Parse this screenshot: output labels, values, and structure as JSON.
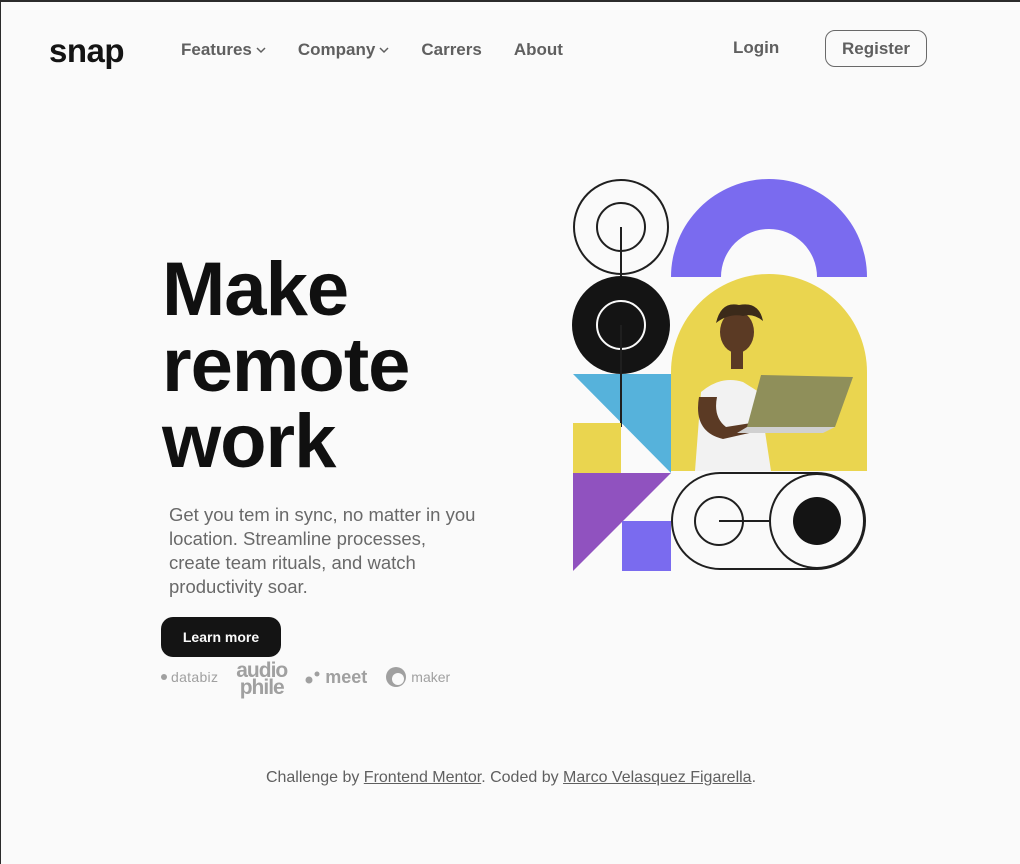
{
  "brand": {
    "logo": "snap"
  },
  "nav": {
    "items": [
      {
        "label": "Features",
        "has_dropdown": true
      },
      {
        "label": "Company",
        "has_dropdown": true
      },
      {
        "label": "Carrers",
        "has_dropdown": false
      },
      {
        "label": "About",
        "has_dropdown": false
      }
    ],
    "login_label": "Login",
    "register_label": "Register"
  },
  "hero": {
    "title_lines": [
      "Make",
      "remote",
      "work"
    ],
    "description": "Get you tem in sync, no matter in you location. Streamline processes, create team rituals, and watch productivity soar.",
    "cta_label": "Learn more"
  },
  "clients": {
    "databiz": "databiz",
    "audiophile_top": "audio",
    "audiophile_bottom": "phile",
    "meet": "meet",
    "maker": "maker"
  },
  "footer": {
    "prefix": "Challenge by ",
    "link1": "Frontend Mentor",
    "middle": ". Coded by ",
    "link2": "Marco Velasquez Figarella",
    "suffix": "."
  },
  "colors": {
    "text": "#141414",
    "muted": "#696969",
    "purple": "#7a6bef",
    "yellow": "#ead54f",
    "blue": "#56b2db",
    "violet": "#9052bf",
    "background": "#fafafa"
  }
}
